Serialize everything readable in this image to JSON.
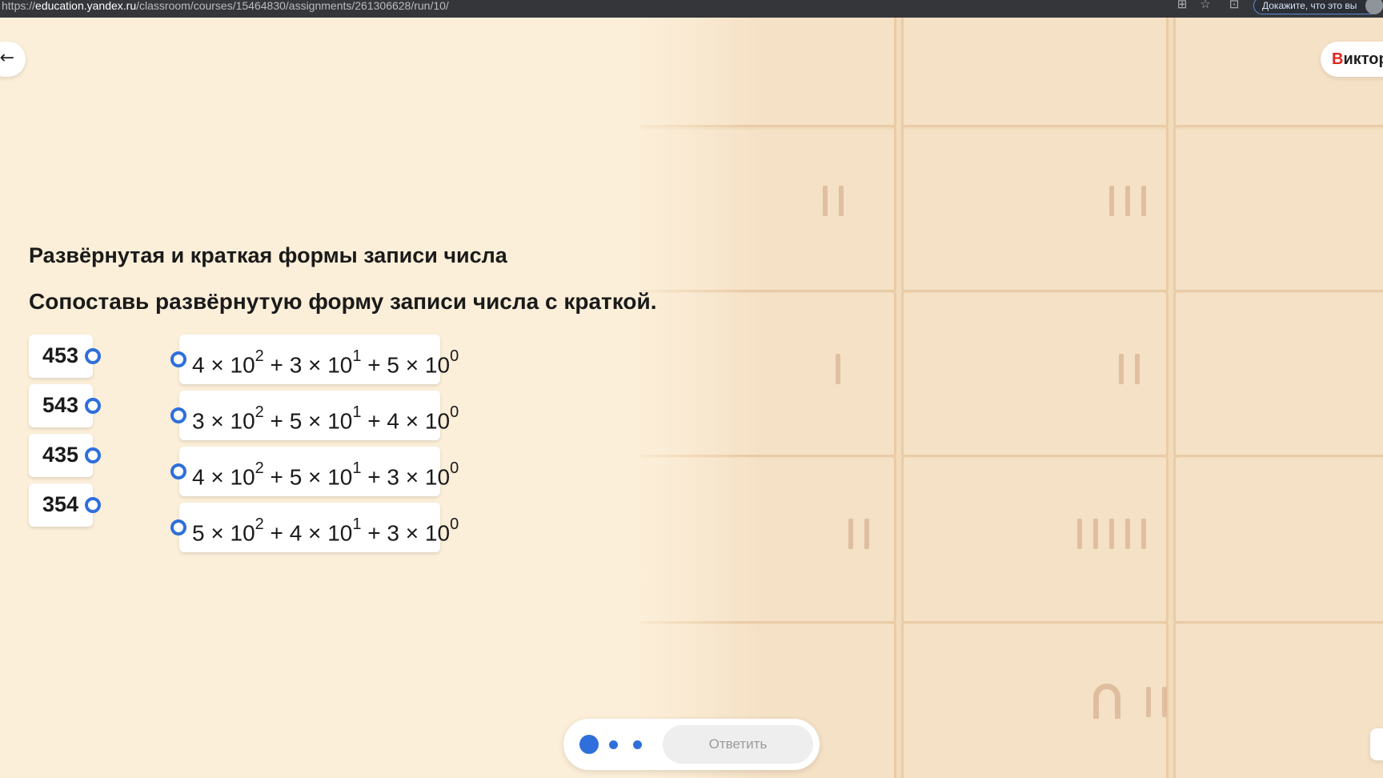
{
  "browser": {
    "url_prefix": "https://",
    "url_host": "education.yandex.ru",
    "url_path": "/classroom/courses/15464830/assignments/261306628/run/10/",
    "prove_label": "Докажите, что это вы"
  },
  "nav": {
    "back_icon": "←",
    "user_first_letter": "В",
    "user_rest": "иктор"
  },
  "task": {
    "title": "Развёрнутая и краткая формы записи числа",
    "instruction": "Сопоставь развёрнутую форму записи числа с краткой."
  },
  "left_items": [
    "453",
    "543",
    "435",
    "354"
  ],
  "right_items": [
    {
      "a": "4",
      "b": "3",
      "c": "5"
    },
    {
      "a": "3",
      "b": "5",
      "c": "4"
    },
    {
      "a": "4",
      "b": "5",
      "c": "3"
    },
    {
      "a": "5",
      "b": "4",
      "c": "3"
    }
  ],
  "expr": {
    "times": " × ",
    "ten": "10",
    "plus": " + ",
    "exp2": "2",
    "exp1": "1",
    "exp0": "0"
  },
  "footer": {
    "answer_label": "Ответить"
  },
  "colors": {
    "accent": "#2f6fdb",
    "background": "#fcefd9",
    "user_letter": "#e1251b"
  }
}
